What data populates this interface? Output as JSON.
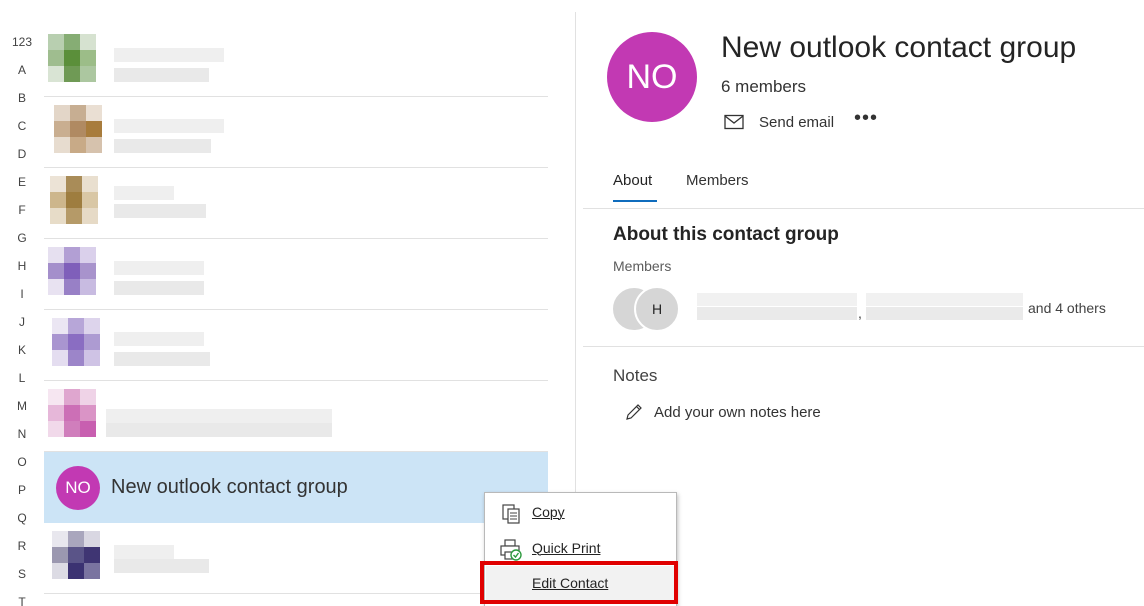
{
  "alpha_index": [
    "123",
    "A",
    "B",
    "C",
    "D",
    "E",
    "F",
    "G",
    "H",
    "I",
    "J",
    "K",
    "L",
    "M",
    "N",
    "O",
    "P",
    "Q",
    "R",
    "S",
    "T"
  ],
  "contact_list": {
    "selected": {
      "initials": "NO",
      "name": "New outlook contact group"
    }
  },
  "group": {
    "initials": "NO",
    "title": "New outlook contact group",
    "members_count": "6 members",
    "send_email_label": "Send email",
    "more_label": "•••"
  },
  "tabs": [
    {
      "label": "About",
      "active": true
    },
    {
      "label": "Members",
      "active": false
    }
  ],
  "about": {
    "section_title": "About this contact group",
    "members_label": "Members",
    "member_avatars": [
      "",
      "H"
    ],
    "and_others": "and 4 others",
    "notes_label": "Notes",
    "add_notes_label": "Add your own notes here"
  },
  "context_menu": {
    "items": [
      {
        "label": "Copy",
        "icon": "copy-icon"
      },
      {
        "label": "Quick Print",
        "icon": "quick-print-icon"
      },
      {
        "label": "Edit Contact",
        "icon": ""
      }
    ]
  },
  "colors": {
    "avatar": "#c239b3",
    "selected_row": "#cce4f6",
    "tab_accent": "#0f6cbd",
    "highlight": "#e00000"
  }
}
